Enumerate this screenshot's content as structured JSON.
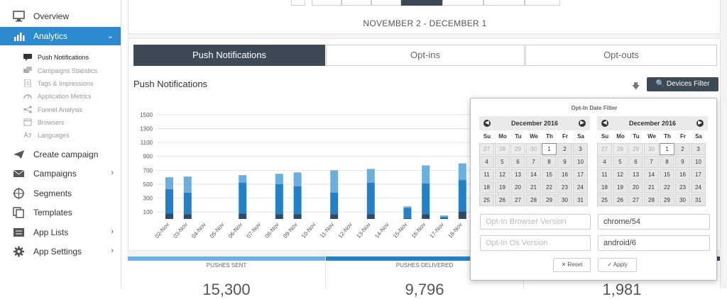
{
  "sidebar": {
    "items": [
      {
        "label": "Overview",
        "icon": "monitor-icon"
      },
      {
        "label": "Analytics",
        "icon": "bar-chart-icon",
        "chevron": "⌄"
      },
      {
        "label": "Create campaign",
        "icon": "paper-plane-icon"
      },
      {
        "label": "Campaigns",
        "icon": "envelope-icon",
        "chevron": "›"
      },
      {
        "label": "Segments",
        "icon": "crosshair-icon"
      },
      {
        "label": "Templates",
        "icon": "documents-icon"
      },
      {
        "label": "App Lists",
        "icon": "list-icon",
        "chevron": "›"
      },
      {
        "label": "App Settings",
        "icon": "gear-icon",
        "chevron": "›"
      }
    ],
    "subitems": [
      {
        "label": "Push Notifications",
        "icon": "message-icon"
      },
      {
        "label": "Campaigns Statistics",
        "icon": "chat-icon"
      },
      {
        "label": "Tags & Impressions",
        "icon": "file-icon"
      },
      {
        "label": "Application Metrics",
        "icon": "gauge-icon"
      },
      {
        "label": "Funnel Analysis",
        "icon": "share-icon"
      },
      {
        "label": "Browsers",
        "icon": "browser-icon"
      },
      {
        "label": "Languages",
        "icon": "language-icon"
      }
    ]
  },
  "header": {
    "date_range": "NOVEMBER 2 - DECEMBER 1"
  },
  "tabs": [
    "Push Notifications",
    "Opt-ins",
    "Opt-outs"
  ],
  "panel": {
    "title": "Push Notifications",
    "filter_button": "Devices Filter",
    "download_icon": "download-icon",
    "filter_icon": "search-icon"
  },
  "chart_data": {
    "type": "bar",
    "stacked": true,
    "categories": [
      "02-Nov",
      "03-Nov",
      "04-Nov",
      "05-Nov",
      "06-Nov",
      "07-Nov",
      "08-Nov",
      "09-Nov",
      "10-Nov",
      "11-Nov",
      "12-Nov",
      "13-Nov",
      "14-Nov",
      "15-Nov",
      "16-Nov",
      "17-Nov",
      "18-Nov"
    ],
    "series": [
      {
        "color": "#2f4a64",
        "values": [
          80,
          70,
          0,
          0,
          80,
          0,
          70,
          70,
          0,
          70,
          0,
          70,
          0,
          10,
          70,
          10,
          110
        ]
      },
      {
        "color": "#2381c8",
        "values": [
          350,
          310,
          0,
          0,
          440,
          0,
          430,
          400,
          0,
          310,
          0,
          450,
          0,
          150,
          440,
          20,
          450
        ]
      },
      {
        "color": "#69b0df",
        "values": [
          170,
          230,
          0,
          0,
          110,
          0,
          150,
          200,
          0,
          320,
          0,
          200,
          0,
          20,
          260,
          20,
          240
        ]
      }
    ],
    "yticks": [
      100,
      300,
      500,
      700,
      900,
      1100,
      1300,
      1500
    ],
    "ylim": [
      0,
      1550
    ],
    "grid": true
  },
  "stats": [
    {
      "label": "PUSHES SENT",
      "value": "15,300",
      "color": "#6ab0e0"
    },
    {
      "label": "PUSHES DELIVERED",
      "value": "9,796",
      "color": "#2381c8"
    },
    {
      "label": "",
      "value": "1,981",
      "color": "#2f4a64"
    }
  ],
  "popup": {
    "title": "Opt-In Date Filter",
    "weekdays": [
      "Su",
      "Mo",
      "Tu",
      "We",
      "Th",
      "Fr",
      "Sa"
    ],
    "calendars": [
      {
        "month": "December 2016",
        "today": "1",
        "days": [
          "27",
          "28",
          "29",
          "30",
          "1",
          "2",
          "3",
          "4",
          "5",
          "6",
          "7",
          "8",
          "9",
          "10",
          "11",
          "12",
          "13",
          "14",
          "15",
          "16",
          "17",
          "18",
          "19",
          "20",
          "21",
          "22",
          "23",
          "24",
          "25",
          "26",
          "27",
          "28",
          "29",
          "30",
          "31"
        ],
        "prev_days": 4
      },
      {
        "month": "December 2016",
        "today": "1",
        "days": [
          "27",
          "28",
          "29",
          "30",
          "1",
          "2",
          "3",
          "4",
          "5",
          "6",
          "7",
          "8",
          "9",
          "10",
          "11",
          "12",
          "13",
          "14",
          "15",
          "16",
          "17",
          "18",
          "19",
          "20",
          "21",
          "22",
          "23",
          "24",
          "25",
          "26",
          "27",
          "28",
          "29",
          "30",
          "31"
        ],
        "prev_days": 4
      }
    ],
    "browser_placeholder": "Opt-In Browser Version",
    "browser_value": "chrome/54",
    "os_placeholder": "Opt-In Os Version",
    "os_value": "android/6",
    "reset": "Reset",
    "apply": "Apply"
  }
}
